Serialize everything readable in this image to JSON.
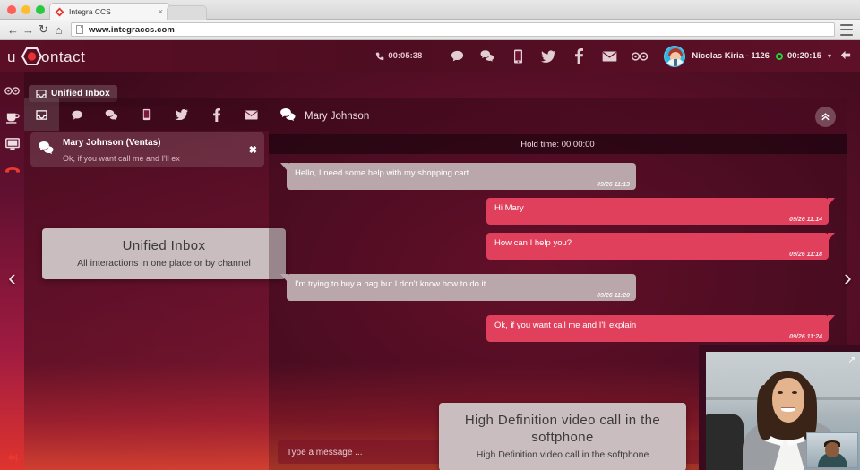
{
  "browser": {
    "tab_title": "Integra CCS",
    "tab_close": "×",
    "url": "www.integraccs.com",
    "back": "←",
    "forward": "→",
    "reload": "↻",
    "home": "⌂"
  },
  "app": {
    "logo_text": "uContact",
    "call_timer": "00:05:38",
    "user_name": "Nicolas Kiria - 1126",
    "user_timer": "00:20:15",
    "caret": "▾",
    "channel_icons": [
      "chat-bubble-icon",
      "chats-icon",
      "mobile-icon",
      "twitter-icon",
      "facebook-icon",
      "email-icon",
      "glasses-icon"
    ]
  },
  "rail": {
    "items": [
      "glasses-icon",
      "coffee-cup-icon",
      "monitor-icon",
      "hangup-phone-icon"
    ],
    "logout": "logout-icon"
  },
  "inbox": {
    "pill_label": "Unified Inbox",
    "tabs": [
      "inbox-icon",
      "chat-bubble-icon",
      "chats-icon",
      "mobile-icon",
      "twitter-icon",
      "facebook-icon",
      "email-icon"
    ],
    "conversation": {
      "name": "Mary Johnson (Ventas)",
      "preview": "Ok, if you want call me and I'll ex",
      "close": "✖"
    }
  },
  "callouts": [
    {
      "title": "Unified Inbox",
      "subtitle": "All interactions in one place or by channel"
    },
    {
      "title": "High Definition video call in the softphone",
      "subtitle": "High Definition video call in the softphone"
    }
  ],
  "carousel": {
    "prev": "‹",
    "next": "›"
  },
  "chat": {
    "title": "Mary Johnson",
    "collapse": "»",
    "hold_time": "Hold time: 00:00:00",
    "composer_placeholder": "Type a message ...",
    "messages": [
      {
        "dir": "in",
        "text": "Hello, I need some help with my shopping cart",
        "time": "09/26 11:13"
      },
      {
        "dir": "out",
        "text": "Hi Mary",
        "time": "09/26 11:14"
      },
      {
        "dir": "out",
        "text": "How can I help you?",
        "time": "09/26 11:18"
      },
      {
        "dir": "in",
        "text": "I'm trying to buy a bag but I don't know how to do it..",
        "time": "09/26 11:20"
      },
      {
        "dir": "out",
        "text": "Ok, if you want call me and I'll explain",
        "time": "09/26 11:24"
      }
    ]
  },
  "video": {
    "expand": "↗"
  },
  "colors": {
    "brand_dark": "#4e0d22",
    "brand_accent": "#e0342e",
    "bubble_out": "#e0405c",
    "bubble_in": "#b9a7ac",
    "status_online": "#1fd43a"
  }
}
